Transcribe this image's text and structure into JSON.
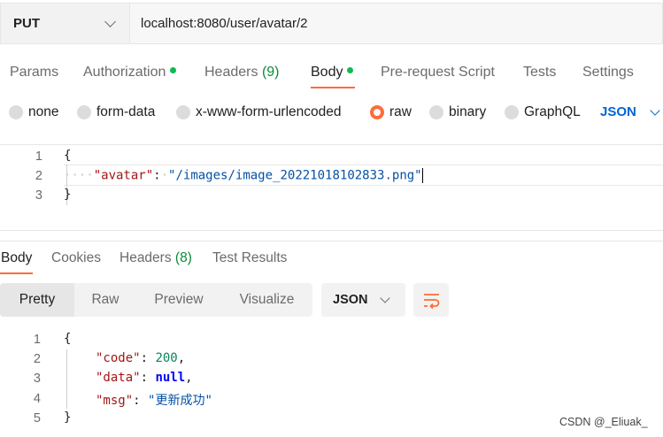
{
  "request": {
    "method": "PUT",
    "url": "localhost:8080/user/avatar/2"
  },
  "request_tabs": [
    {
      "label": "Params"
    },
    {
      "label": "Authorization",
      "dot": true
    },
    {
      "label": "Headers",
      "count": "(9)"
    },
    {
      "label": "Body",
      "dot": true,
      "active": true
    },
    {
      "label": "Pre-request Script"
    },
    {
      "label": "Tests"
    },
    {
      "label": "Settings"
    }
  ],
  "body_types": [
    {
      "label": "none"
    },
    {
      "label": "form-data"
    },
    {
      "label": "x-www-form-urlencoded"
    },
    {
      "label": "raw",
      "selected": true
    },
    {
      "label": "binary"
    },
    {
      "label": "GraphQL"
    }
  ],
  "body_language": "JSON",
  "request_body": {
    "line_numbers": [
      "1",
      "2",
      "3"
    ],
    "open_brace": "{",
    "key": "\"avatar\"",
    "colon": ":",
    "value": "\"/images/image_20221018102833.png\"",
    "close_brace": "}"
  },
  "response_tabs": [
    {
      "label": "Body",
      "active": true
    },
    {
      "label": "Cookies"
    },
    {
      "label": "Headers",
      "count": "(8)"
    },
    {
      "label": "Test Results"
    }
  ],
  "view_modes": [
    "Pretty",
    "Raw",
    "Preview",
    "Visualize"
  ],
  "response_format": "JSON",
  "response_body": {
    "line_numbers": [
      "1",
      "2",
      "3",
      "4",
      "5"
    ],
    "open_brace": "{",
    "code_key": "\"code\"",
    "code_value": "200",
    "data_key": "\"data\"",
    "data_value": "null",
    "msg_key": "\"msg\"",
    "msg_value": "\"更新成功\"",
    "close_brace": "}"
  },
  "watermark": "CSDN @_Eliuak_",
  "colors": {
    "accent": "#ff6c37",
    "dot_green": "#0cbb52",
    "link_blue": "#0265d2"
  }
}
